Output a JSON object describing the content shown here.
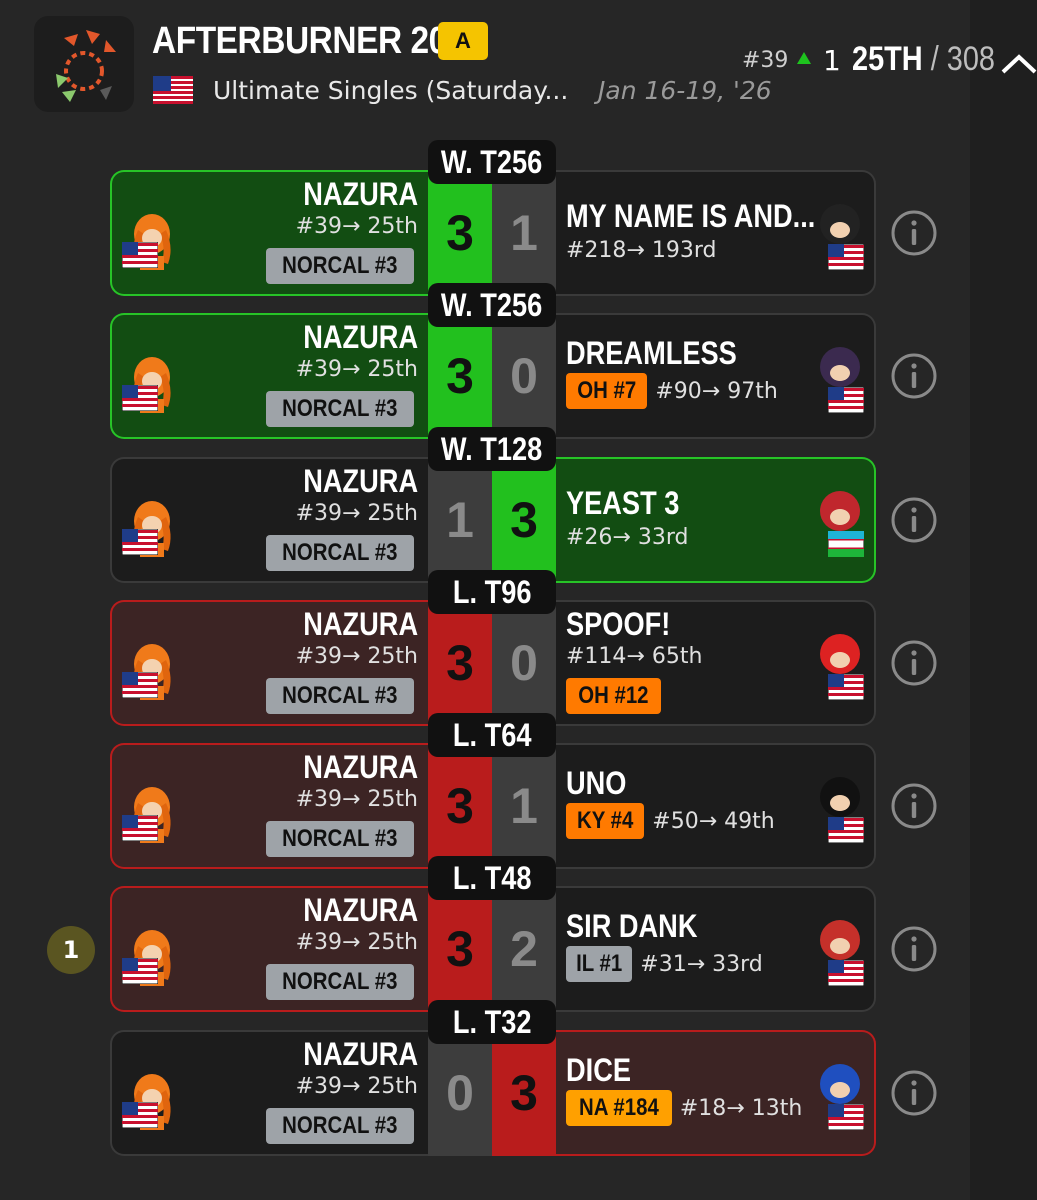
{
  "header": {
    "title": "AFTERBURNER 2026",
    "tier": "A",
    "event_name": "Ultimate Singles (Saturday...",
    "date": "Jan 16-19, '26",
    "seed": "#39",
    "change": "1",
    "placing": "25TH",
    "total": "/ 308"
  },
  "colors": {
    "win": "#22c01e",
    "loss": "#b91c1c",
    "tier": "#f5c400",
    "neutral": "#3d3d3d"
  },
  "matches": [
    {
      "round": "W. T256",
      "p1": {
        "name": "NAZURA",
        "rank": "#39→ 25th",
        "tag": "NORCAL #3"
      },
      "p1_score": "3",
      "p2_score": "1",
      "p2": {
        "name": "MY NAME IS AND...",
        "rank": "#218→ 193rd",
        "tag": ""
      }
    },
    {
      "round": "W. T256",
      "p1": {
        "name": "NAZURA",
        "rank": "#39→ 25th",
        "tag": "NORCAL #3"
      },
      "p1_score": "3",
      "p2_score": "0",
      "p2": {
        "name": "DREAMLESS",
        "rank": "#90→ 97th",
        "tag": "OH #7"
      }
    },
    {
      "round": "W. T128",
      "p1": {
        "name": "NAZURA",
        "rank": "#39→ 25th",
        "tag": "NORCAL #3"
      },
      "p1_score": "1",
      "p2_score": "3",
      "p2": {
        "name": "YEAST 3",
        "rank": "#26→ 33rd",
        "tag": ""
      }
    },
    {
      "round": "L. T96",
      "p1": {
        "name": "NAZURA",
        "rank": "#39→ 25th",
        "tag": "NORCAL #3"
      },
      "p1_score": "3",
      "p2_score": "0",
      "p2": {
        "name": "SPOOF!",
        "rank": "#114→ 65th",
        "tag": "OH #12"
      }
    },
    {
      "round": "L. T64",
      "p1": {
        "name": "NAZURA",
        "rank": "#39→ 25th",
        "tag": "NORCAL #3"
      },
      "p1_score": "3",
      "p2_score": "1",
      "p2": {
        "name": "UNO",
        "rank": "#50→ 49th",
        "tag": "KY #4"
      }
    },
    {
      "round": "L. T48",
      "p1": {
        "name": "NAZURA",
        "rank": "#39→ 25th",
        "tag": "NORCAL #3"
      },
      "p1_score": "3",
      "p2_score": "2",
      "p2": {
        "name": "SIR DANK",
        "rank": "#31→ 33rd",
        "tag": "IL #1"
      }
    },
    {
      "round": "L. T32",
      "p1": {
        "name": "NAZURA",
        "rank": "#39→ 25th",
        "tag": "NORCAL #3"
      },
      "p1_score": "0",
      "p2_score": "3",
      "p2": {
        "name": "DICE",
        "rank": "#18→ 13th",
        "tag": "NA #184"
      }
    }
  ],
  "step_badge": "1"
}
